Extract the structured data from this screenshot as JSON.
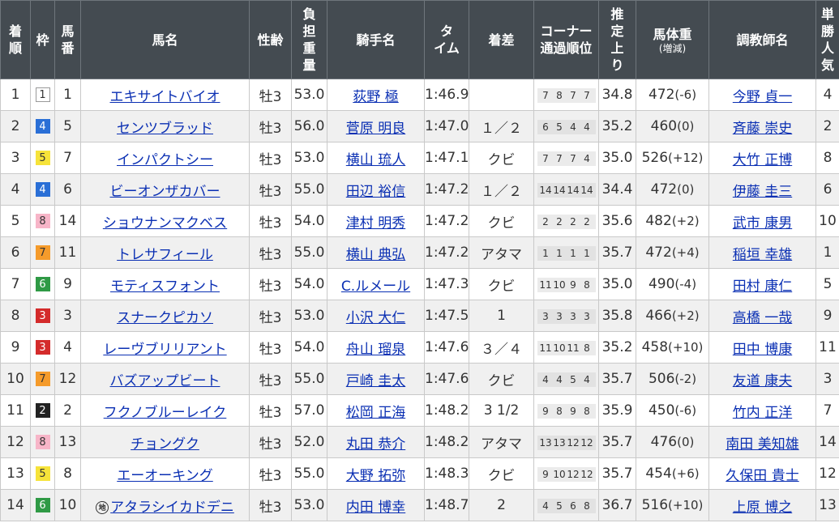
{
  "headers": {
    "rank": "着順",
    "waku": "枠",
    "umaban": "馬番",
    "horse": "馬名",
    "sexage": "性齢",
    "weight": "負担重量",
    "jockey": "騎手名",
    "time": "タイム",
    "margin": "着差",
    "corner_line1": "コーナー",
    "corner_line2": "通過順位",
    "last3f": "推定上り",
    "body_line1": "馬体重",
    "body_line2": "(増減)",
    "trainer": "調教師名",
    "pop": "単勝人気"
  },
  "chi_label": "地",
  "waku_colors": {
    "1": {
      "bg": "#ffffff",
      "fg": "#333333",
      "border": "#999999"
    },
    "2": {
      "bg": "#222222",
      "fg": "#ffffff",
      "border": "#222222"
    },
    "3": {
      "bg": "#d42b2b",
      "fg": "#ffffff",
      "border": "#d42b2b"
    },
    "4": {
      "bg": "#2a6fd6",
      "fg": "#ffffff",
      "border": "#2a6fd6"
    },
    "5": {
      "bg": "#f6e33a",
      "fg": "#333333",
      "border": "#f6e33a"
    },
    "6": {
      "bg": "#2f9a45",
      "fg": "#ffffff",
      "border": "#2f9a45"
    },
    "7": {
      "bg": "#f59b2b",
      "fg": "#333333",
      "border": "#f59b2b"
    },
    "8": {
      "bg": "#f7b5c8",
      "fg": "#333333",
      "border": "#f7b5c8"
    }
  },
  "rows": [
    {
      "rank": "1",
      "waku": "1",
      "umaban": "1",
      "horse": "エキサイトバイオ",
      "chi": false,
      "sexage": "牡3",
      "weight": "53.0",
      "jockey": "荻野 極",
      "time": "1:46.9",
      "margin": "",
      "corner": [
        "7",
        "8",
        "7",
        "7"
      ],
      "last3f": "34.8",
      "body": "472",
      "diff": "(-6)",
      "trainer": "今野 貞一",
      "pop": "4"
    },
    {
      "rank": "2",
      "waku": "4",
      "umaban": "5",
      "horse": "センツブラッド",
      "chi": false,
      "sexage": "牡3",
      "weight": "56.0",
      "jockey": "菅原 明良",
      "time": "1:47.0",
      "margin": "１／２",
      "corner": [
        "6",
        "5",
        "4",
        "4"
      ],
      "last3f": "35.2",
      "body": "460",
      "diff": "(0)",
      "trainer": "斉藤 崇史",
      "pop": "2"
    },
    {
      "rank": "3",
      "waku": "5",
      "umaban": "7",
      "horse": "インパクトシー",
      "chi": false,
      "sexage": "牡3",
      "weight": "53.0",
      "jockey": "横山 琉人",
      "time": "1:47.1",
      "margin": "クビ",
      "corner": [
        "7",
        "7",
        "7",
        "4"
      ],
      "last3f": "35.0",
      "body": "526",
      "diff": "(+12)",
      "trainer": "大竹 正博",
      "pop": "8"
    },
    {
      "rank": "4",
      "waku": "4",
      "umaban": "6",
      "horse": "ビーオンザカバー",
      "chi": false,
      "sexage": "牡3",
      "weight": "55.0",
      "jockey": "田辺 裕信",
      "time": "1:47.2",
      "margin": "１／２",
      "corner": [
        "14",
        "14",
        "14",
        "14"
      ],
      "last3f": "34.4",
      "body": "472",
      "diff": "(0)",
      "trainer": "伊藤 圭三",
      "pop": "6"
    },
    {
      "rank": "5",
      "waku": "8",
      "umaban": "14",
      "horse": "ショウナンマクベス",
      "chi": false,
      "sexage": "牡3",
      "weight": "54.0",
      "jockey": "津村 明秀",
      "time": "1:47.2",
      "margin": "クビ",
      "corner": [
        "2",
        "2",
        "2",
        "2"
      ],
      "last3f": "35.6",
      "body": "482",
      "diff": "(+2)",
      "trainer": "武市 康男",
      "pop": "10"
    },
    {
      "rank": "6",
      "waku": "7",
      "umaban": "11",
      "horse": "トレサフィール",
      "chi": false,
      "sexage": "牡3",
      "weight": "55.0",
      "jockey": "横山 典弘",
      "time": "1:47.2",
      "margin": "アタマ",
      "corner": [
        "1",
        "1",
        "1",
        "1"
      ],
      "last3f": "35.7",
      "body": "472",
      "diff": "(+4)",
      "trainer": "稲垣 幸雄",
      "pop": "1"
    },
    {
      "rank": "7",
      "waku": "6",
      "umaban": "9",
      "horse": "モティスフォント",
      "chi": false,
      "sexage": "牡3",
      "weight": "54.0",
      "jockey": "C.ルメール",
      "time": "1:47.3",
      "margin": "クビ",
      "corner": [
        "11",
        "10",
        "9",
        "8"
      ],
      "last3f": "35.0",
      "body": "490",
      "diff": "(-4)",
      "trainer": "田村 康仁",
      "pop": "5"
    },
    {
      "rank": "8",
      "waku": "3",
      "umaban": "3",
      "horse": "スナークピカソ",
      "chi": false,
      "sexage": "牡3",
      "weight": "53.0",
      "jockey": "小沢 大仁",
      "time": "1:47.5",
      "margin": "1",
      "corner": [
        "3",
        "3",
        "3",
        "3"
      ],
      "last3f": "35.8",
      "body": "466",
      "diff": "(+2)",
      "trainer": "高橋 一哉",
      "pop": "9"
    },
    {
      "rank": "9",
      "waku": "3",
      "umaban": "4",
      "horse": "レーヴブリリアント",
      "chi": false,
      "sexage": "牡3",
      "weight": "54.0",
      "jockey": "舟山 瑠泉",
      "time": "1:47.6",
      "margin": "３／４",
      "corner": [
        "11",
        "10",
        "11",
        "8"
      ],
      "last3f": "35.2",
      "body": "458",
      "diff": "(+10)",
      "trainer": "田中 博康",
      "pop": "11"
    },
    {
      "rank": "10",
      "waku": "7",
      "umaban": "12",
      "horse": "バズアップビート",
      "chi": false,
      "sexage": "牡3",
      "weight": "55.0",
      "jockey": "戸崎 圭太",
      "time": "1:47.6",
      "margin": "クビ",
      "corner": [
        "4",
        "4",
        "5",
        "4"
      ],
      "last3f": "35.7",
      "body": "506",
      "diff": "(-2)",
      "trainer": "友道 康夫",
      "pop": "3"
    },
    {
      "rank": "11",
      "waku": "2",
      "umaban": "2",
      "horse": "フクノブルーレイク",
      "chi": false,
      "sexage": "牡3",
      "weight": "57.0",
      "jockey": "松岡 正海",
      "time": "1:48.2",
      "margin": "3 1/2",
      "corner": [
        "9",
        "8",
        "9",
        "8"
      ],
      "last3f": "35.9",
      "body": "450",
      "diff": "(-6)",
      "trainer": "竹内 正洋",
      "pop": "7"
    },
    {
      "rank": "12",
      "waku": "8",
      "umaban": "13",
      "horse": "チョングク",
      "chi": false,
      "sexage": "牡3",
      "weight": "52.0",
      "jockey": "丸田 恭介",
      "time": "1:48.2",
      "margin": "アタマ",
      "corner": [
        "13",
        "13",
        "12",
        "12"
      ],
      "last3f": "35.7",
      "body": "476",
      "diff": "(0)",
      "trainer": "南田 美知雄",
      "pop": "14"
    },
    {
      "rank": "13",
      "waku": "5",
      "umaban": "8",
      "horse": "エーオーキング",
      "chi": false,
      "sexage": "牡3",
      "weight": "55.0",
      "jockey": "大野 拓弥",
      "time": "1:48.3",
      "margin": "クビ",
      "corner": [
        "9",
        "10",
        "12",
        "12"
      ],
      "last3f": "35.7",
      "body": "454",
      "diff": "(+6)",
      "trainer": "久保田 貴士",
      "pop": "12"
    },
    {
      "rank": "14",
      "waku": "6",
      "umaban": "10",
      "horse": "アタラシイカドデニ",
      "chi": true,
      "sexage": "牡3",
      "weight": "53.0",
      "jockey": "内田 博幸",
      "time": "1:48.7",
      "margin": "2",
      "corner": [
        "4",
        "5",
        "6",
        "8"
      ],
      "last3f": "36.7",
      "body": "516",
      "diff": "(+10)",
      "trainer": "上原 博之",
      "pop": "13"
    }
  ]
}
